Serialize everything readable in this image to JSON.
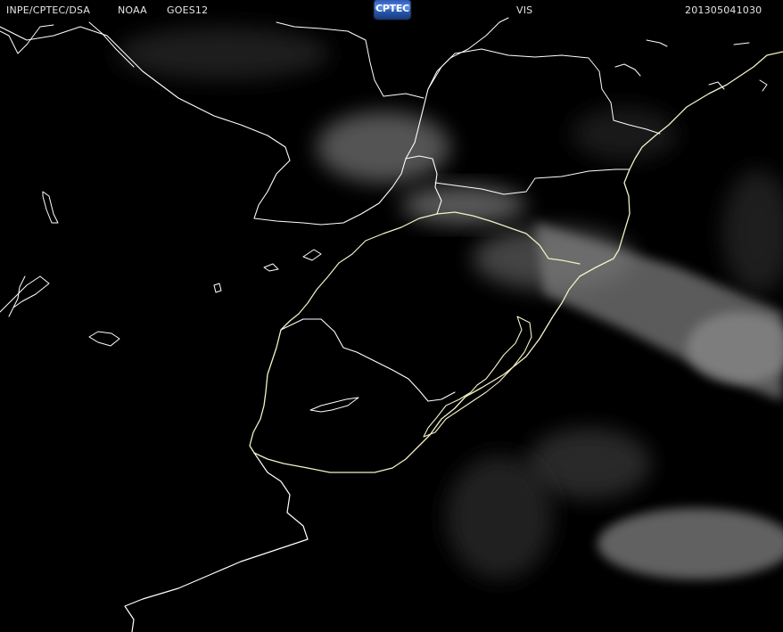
{
  "header": {
    "organization": "INPE/CPTEC/DSA",
    "agency": "NOAA",
    "satellite": "GOES12",
    "channel": "VIS",
    "timestamp": "201305041030"
  },
  "logo": {
    "text": "CPTEC",
    "name": "cptec-logo"
  },
  "colors": {
    "background": "#000000",
    "coastline": "#f4f1c8",
    "border": "#ffffff",
    "header_text": "#e6e6e6",
    "cloud": "#9a9a9a"
  }
}
